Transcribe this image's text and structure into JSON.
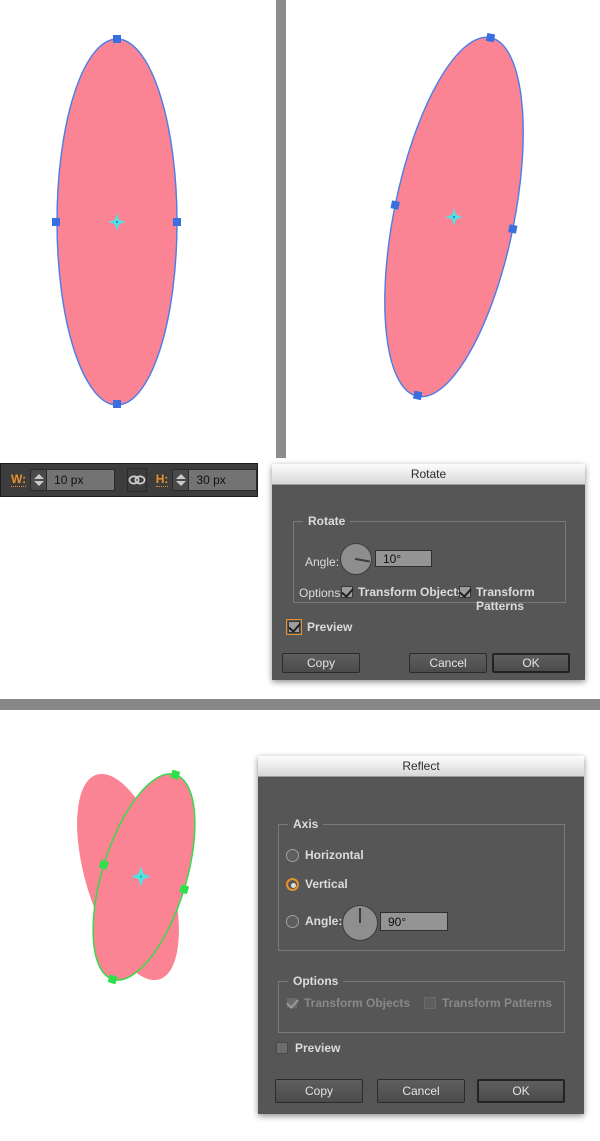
{
  "app": "Adobe Illustrator transform dialogs",
  "toolbar": {
    "width_label": "W:",
    "width_value": "10 px",
    "height_label": "H:",
    "height_value": "30 px",
    "link_icon": "chain-link-icon",
    "link_title": "Constrain Width and Height Proportions"
  },
  "rotate_dialog": {
    "title": "Rotate",
    "group_legend": "Rotate",
    "angle_label": "Angle:",
    "angle_value": "10°",
    "angle_degrees": 10,
    "options_label": "Options:",
    "transform_objects_label": "Transform Objects",
    "transform_objects_checked": true,
    "transform_patterns_label": "Transform Patterns",
    "transform_patterns_checked": true,
    "preview_label": "Preview",
    "preview_checked": true,
    "copy_label": "Copy",
    "cancel_label": "Cancel",
    "ok_label": "OK"
  },
  "reflect_dialog": {
    "title": "Reflect",
    "axis_legend": "Axis",
    "horizontal_label": "Horizontal",
    "horizontal_selected": false,
    "horizontal_icon": "flip-horizontal-icon",
    "vertical_label": "Vertical",
    "vertical_selected": true,
    "vertical_icon": "flip-vertical-icon",
    "angle_label": "Angle:",
    "angle_selected": false,
    "angle_value": "90°",
    "angle_degrees": 90,
    "options_legend": "Options",
    "transform_objects_label": "Transform Objects",
    "transform_objects_checked": true,
    "transform_objects_disabled": true,
    "transform_patterns_label": "Transform Patterns",
    "transform_patterns_checked": false,
    "transform_patterns_disabled": true,
    "preview_label": "Preview",
    "preview_checked": false,
    "copy_label": "Copy",
    "cancel_label": "Cancel",
    "ok_label": "OK"
  },
  "artwork": {
    "fill_color": "#fa8493",
    "selection_stroke_blue": "#4a7dea",
    "selection_stroke_green": "#39d94f",
    "anchor_blue": "#3a6fe0",
    "anchor_green": "#2ee04a",
    "center_marker_cyan": "#4fe4e4",
    "shapes": [
      {
        "name": "ellipse-upright",
        "description": "Upright pink ellipse, 10 px by 30 px, blue selection anchors and cyan center origin marker",
        "rotation_degrees": 0
      },
      {
        "name": "ellipse-rotated",
        "description": "Same ellipse rotated 10 degrees clockwise with blue selection anchors and cyan center origin marker",
        "rotation_degrees": 10
      },
      {
        "name": "heart-preview-left",
        "description": "Original rotated ellipse of the heart preview, pink, unselected",
        "rotation_degrees": -16
      },
      {
        "name": "heart-preview-right",
        "description": "Reflected copy of the ellipse forming the heart, green selection outline and anchors",
        "rotation_degrees": 16
      }
    ]
  }
}
